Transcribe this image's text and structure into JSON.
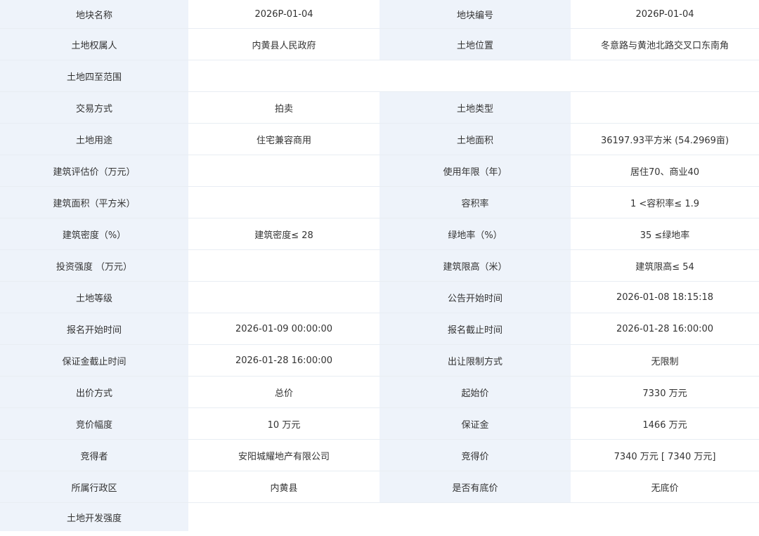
{
  "rows": [
    [
      {
        "label": "地块名称",
        "value": "2026P-01-04"
      },
      {
        "label": "地块编号",
        "value": "2026P-01-04"
      }
    ],
    [
      {
        "label": "土地权属人",
        "value": "内黄县人民政府"
      },
      {
        "label": "土地位置",
        "value": "冬意路与黄池北路交叉口东南角"
      }
    ],
    [
      {
        "label": "土地四至范围",
        "value": ""
      }
    ],
    [
      {
        "label": "交易方式",
        "value": "拍卖"
      },
      {
        "label": "土地类型",
        "value": ""
      }
    ],
    [
      {
        "label": "土地用途",
        "value": "住宅兼容商用"
      },
      {
        "label": "土地面积",
        "value": "36197.93平方米 (54.2969亩)"
      }
    ],
    [
      {
        "label": "建筑评估价（万元）",
        "value": ""
      },
      {
        "label": "使用年限（年）",
        "value": "居住70、商业40"
      }
    ],
    [
      {
        "label": "建筑面积（平方米）",
        "value": ""
      },
      {
        "label": "容积率",
        "value": "1 <容积率≤ 1.9"
      }
    ],
    [
      {
        "label": "建筑密度（%）",
        "value": "建筑密度≤ 28"
      },
      {
        "label": "绿地率（%）",
        "value": "35 ≤绿地率"
      }
    ],
    [
      {
        "label": "投资强度 （万元）",
        "value": ""
      },
      {
        "label": "建筑限高（米）",
        "value": "建筑限高≤ 54"
      }
    ],
    [
      {
        "label": "土地等级",
        "value": ""
      },
      {
        "label": "公告开始时间",
        "value": "2026-01-08 18:15:18"
      }
    ],
    [
      {
        "label": "报名开始时间",
        "value": "2026-01-09 00:00:00"
      },
      {
        "label": "报名截止时间",
        "value": "2026-01-28 16:00:00"
      }
    ],
    [
      {
        "label": "保证金截止时间",
        "value": "2026-01-28 16:00:00"
      },
      {
        "label": "出让限制方式",
        "value": "无限制"
      }
    ],
    [
      {
        "label": "出价方式",
        "value": "总价"
      },
      {
        "label": "起始价",
        "value": "7330 万元"
      }
    ],
    [
      {
        "label": "竞价幅度",
        "value": "10 万元"
      },
      {
        "label": "保证金",
        "value": "1466 万元"
      }
    ],
    [
      {
        "label": "竞得者",
        "value": "安阳城耀地产有限公司"
      },
      {
        "label": "竞得价",
        "value": "7340 万元 [ 7340 万元]"
      }
    ],
    [
      {
        "label": "所属行政区",
        "value": "内黄县"
      },
      {
        "label": "是否有底价",
        "value": "无底价"
      }
    ],
    [
      {
        "label": "土地开发强度",
        "value": ""
      }
    ]
  ]
}
